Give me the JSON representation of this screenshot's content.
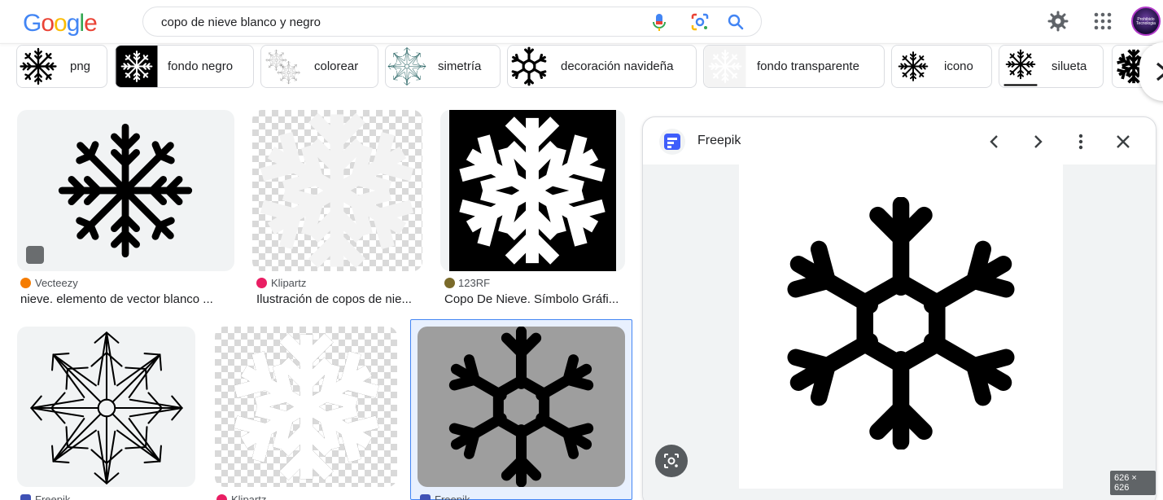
{
  "search": {
    "query": "copo de nieve blanco y negro"
  },
  "logo": [
    "G",
    "o",
    "o",
    "g",
    "l",
    "e"
  ],
  "logo_colors": [
    "#4285F4",
    "#EA4335",
    "#FBBC05",
    "#4285F4",
    "#34A853",
    "#EA4335"
  ],
  "chips": [
    {
      "label": "png"
    },
    {
      "label": "fondo negro"
    },
    {
      "label": "colorear"
    },
    {
      "label": "simetría"
    },
    {
      "label": "decoración navideña"
    },
    {
      "label": "fondo transparente"
    },
    {
      "label": "icono"
    },
    {
      "label": "silueta"
    }
  ],
  "results": [
    {
      "source": "Vecteezy",
      "caption": "nieve. elemento de vector blanco ..."
    },
    {
      "source": "Klipartz",
      "caption": "Ilustración de copos de nie..."
    },
    {
      "source": "123RF",
      "caption": "Copo De Nieve. Símbolo Gráfi..."
    },
    {
      "source": "Freepik",
      "caption": ""
    },
    {
      "source": "Klipartz",
      "caption": ""
    },
    {
      "source": "Freepik",
      "caption": ""
    }
  ],
  "panel": {
    "source": "Freepik",
    "dimensions": "626 × 626"
  },
  "avatar_text": "Prohibido Tecnologia",
  "colors": {
    "accent": "#4285f4",
    "selected_bg": "#e8f0fe"
  }
}
